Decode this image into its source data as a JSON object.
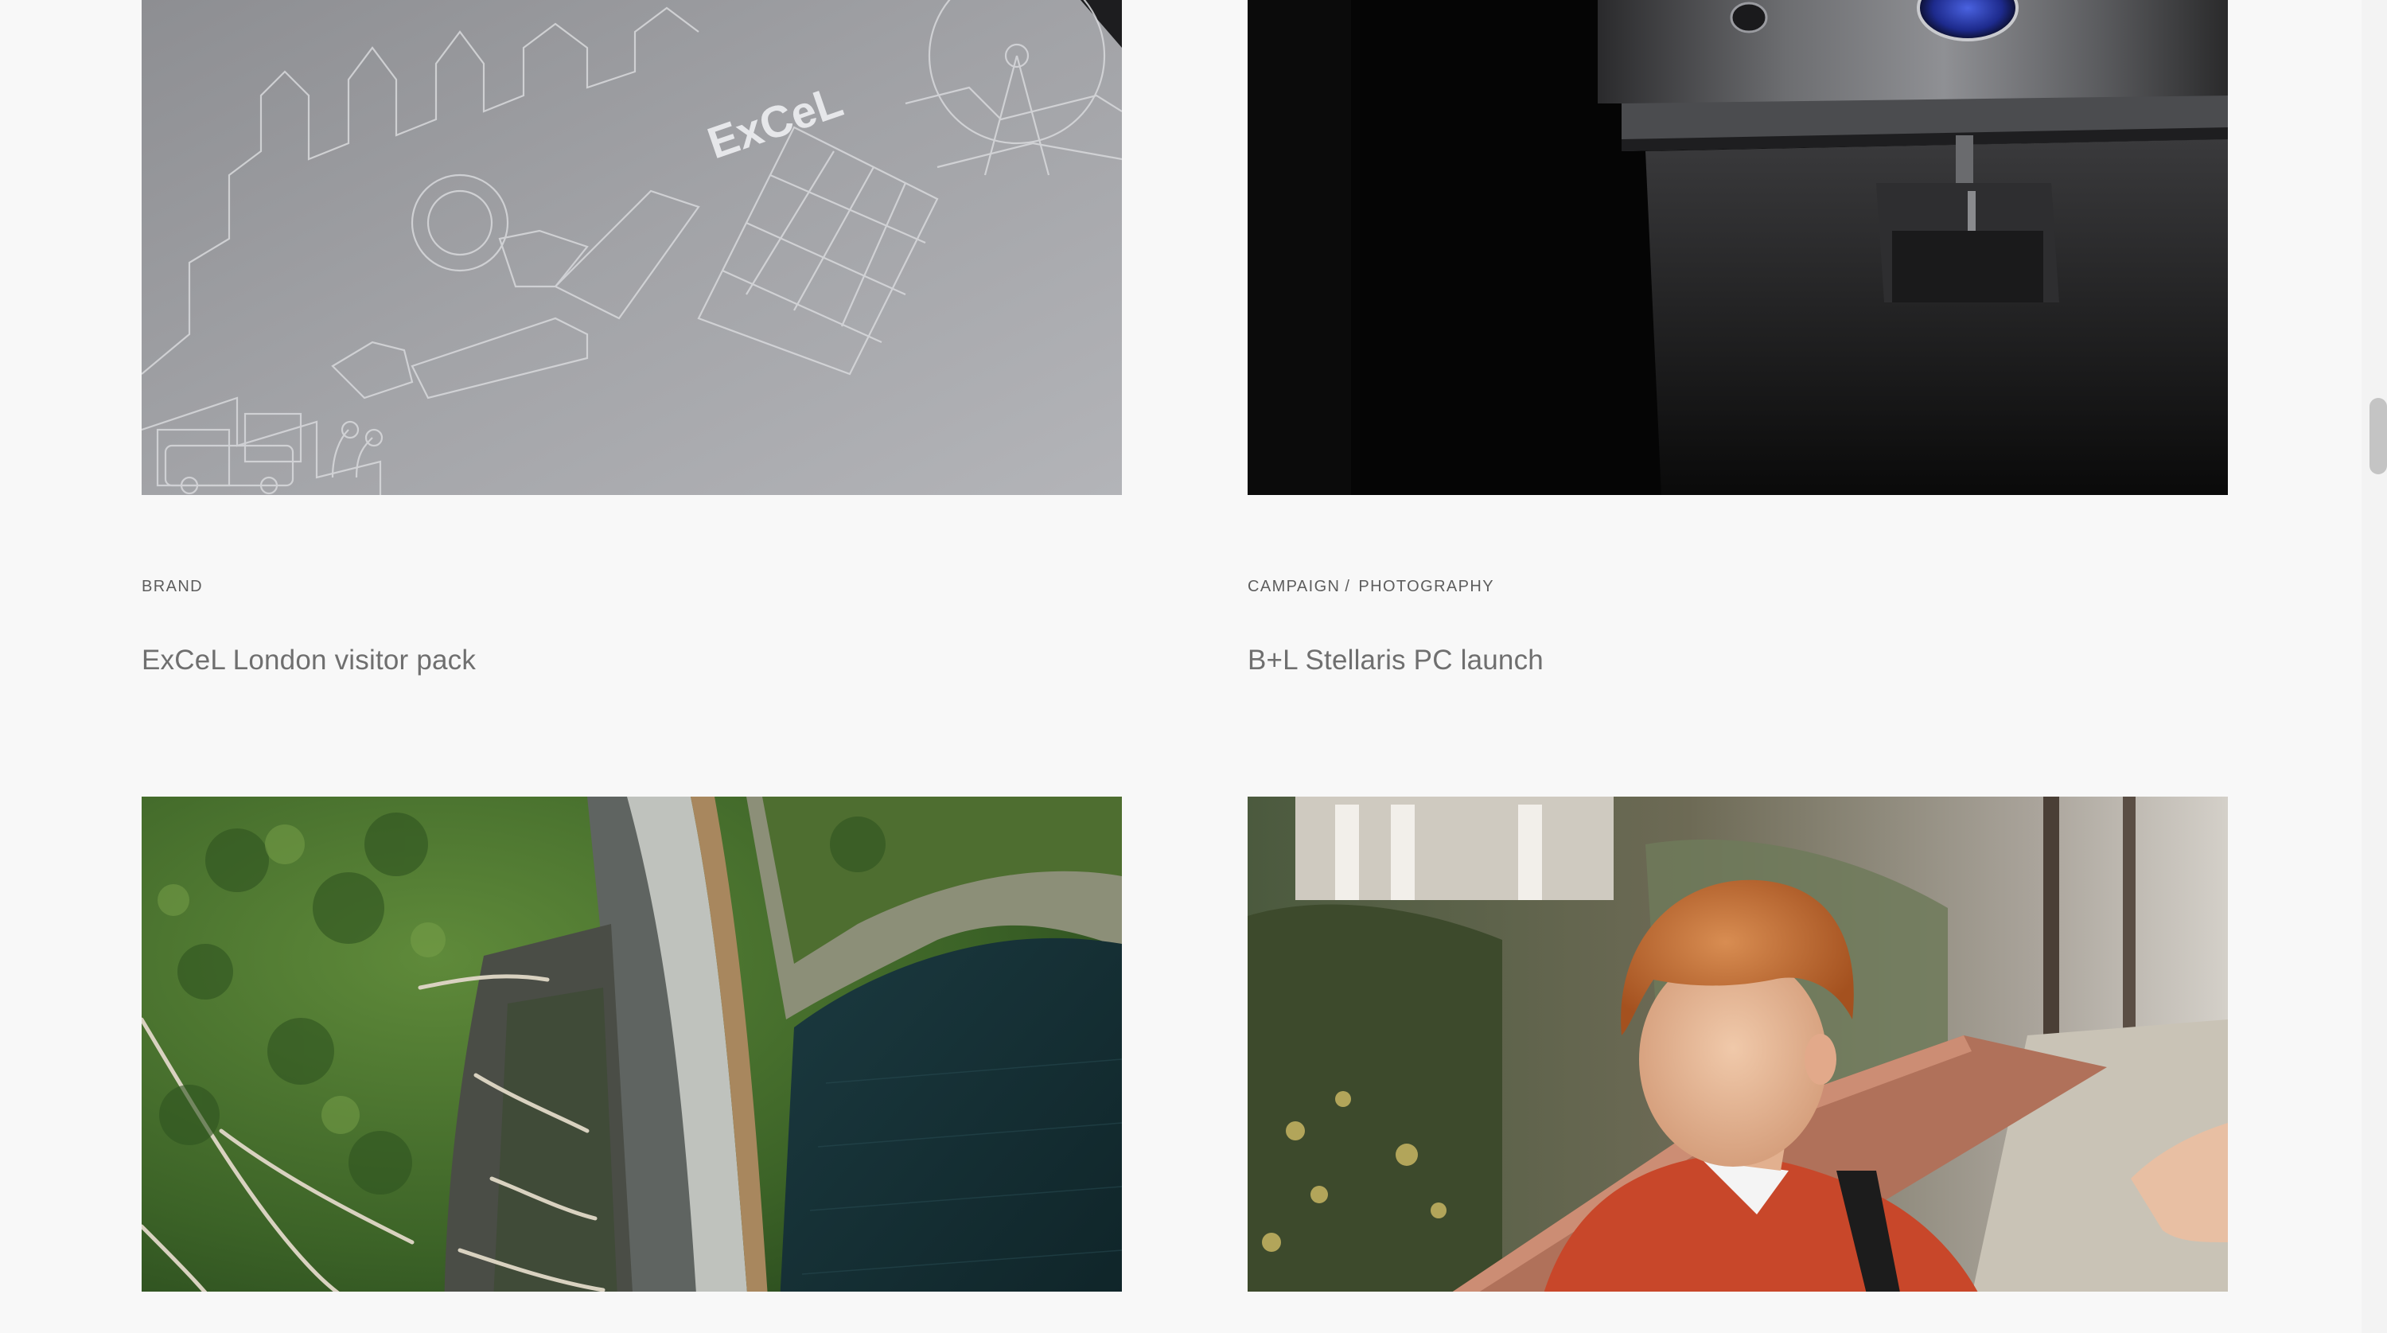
{
  "projects": [
    {
      "tags": [
        "Brand"
      ],
      "title": "ExCeL London visitor pack",
      "image": {
        "alt": "Embossed London skyline illustration on grey card",
        "logo_text": "ExCeL"
      }
    },
    {
      "tags": [
        "Campaign",
        "Photography"
      ],
      "title": "B+L Stellaris PC launch",
      "image": {
        "alt": "Dark product shot of phaco console"
      }
    },
    {
      "tags": [],
      "title": "",
      "image": {
        "alt": "Aerial view of a dam with green forest and dark reservoir"
      }
    },
    {
      "tags": [],
      "title": "",
      "image": {
        "alt": "Red-haired boy in red school jumper holding an adult's hand"
      }
    }
  ],
  "colors": {
    "background": "#f8f8f8",
    "tag_text": "#5d5d5d",
    "title_text": "#6f6f6f",
    "scroll_thumb": "#c4c4c4"
  }
}
